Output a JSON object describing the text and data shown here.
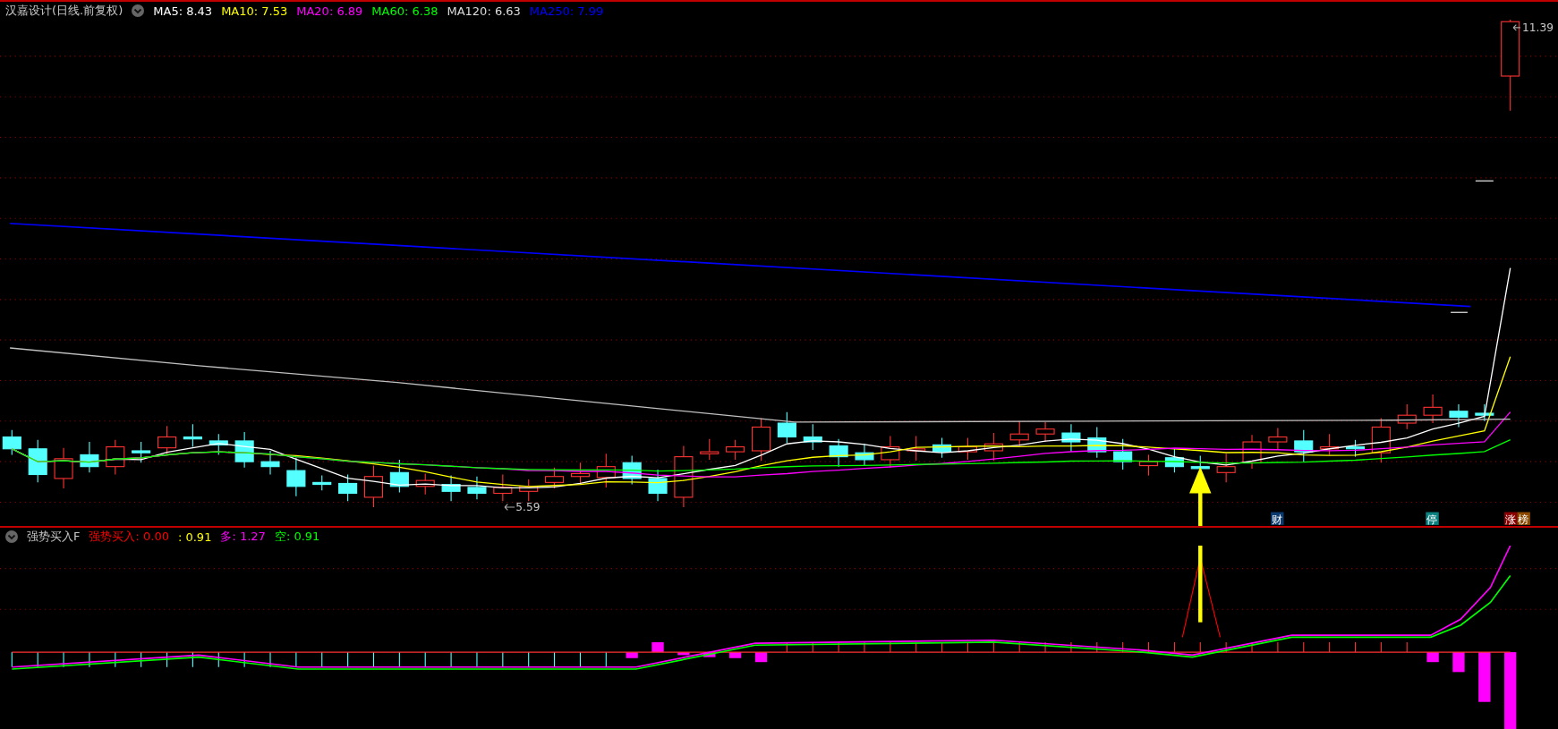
{
  "main_panel": {
    "title": "汉嘉设计(日线.前复权)",
    "legend": [
      {
        "label": "MA5: 8.43",
        "color": "#ffffff"
      },
      {
        "label": "MA10: 7.53",
        "color": "#ffff00"
      },
      {
        "label": "MA20: 6.89",
        "color": "#ff00ff"
      },
      {
        "label": "MA60: 6.38",
        "color": "#00ff00"
      },
      {
        "label": "MA120: 6.63",
        "color": "#dcdcdc"
      },
      {
        "label": "MA250: 7.99",
        "color": "#0000ff"
      }
    ],
    "high_label": "11.39",
    "low_label": "5.59",
    "markers": [
      {
        "text": "财",
        "color": "#0b3a6e"
      },
      {
        "text": "停",
        "color": "#0a8080"
      },
      {
        "text": "涨",
        "color": "#8b0000"
      },
      {
        "text": "榜",
        "color": "#8b4a00"
      }
    ]
  },
  "indicator_panel": {
    "title": "强势买入F",
    "legend": [
      {
        "label": "强势买入: 0.00",
        "color": "#ff0000"
      },
      {
        "label": ": 0.91",
        "color": "#ffff00"
      },
      {
        "label": "多: 1.27",
        "color": "#ff00ff"
      },
      {
        "label": "空: 0.91",
        "color": "#00ff00"
      }
    ]
  }
}
